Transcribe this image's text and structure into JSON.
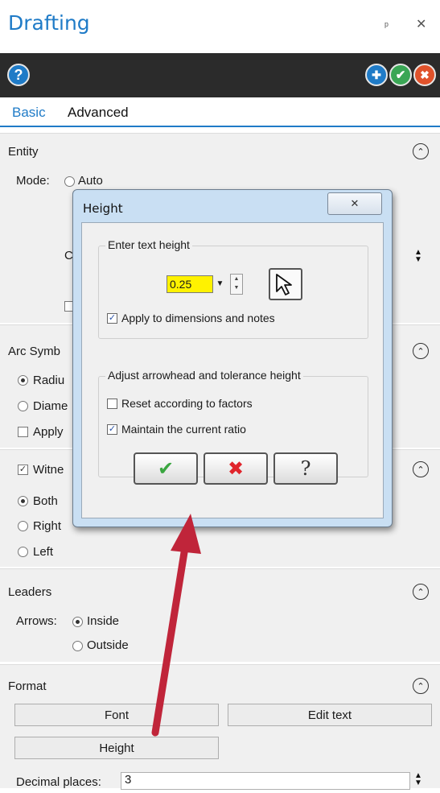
{
  "panel": {
    "title": "Drafting",
    "pin": "ᵖ",
    "close": "✕"
  },
  "toolbar": {
    "help": "?",
    "apply_new": "✚",
    "ok": "✔",
    "cancel": "✖"
  },
  "tabs": [
    {
      "label": "Basic"
    },
    {
      "label": "Advanced"
    }
  ],
  "entity": {
    "title": "Entity",
    "mode_label": "Mode:",
    "auto_label": "Auto",
    "partial_c": "C"
  },
  "arc": {
    "title": "Arc Symb",
    "radius": "Radiu",
    "diameter": "Diame",
    "apply": "Apply"
  },
  "witness": {
    "title": "Witne",
    "both": "Both",
    "right": "Right",
    "left": "Left"
  },
  "leaders": {
    "title": "Leaders",
    "arrows_label": "Arrows:",
    "inside": "Inside",
    "outside": "Outside"
  },
  "format": {
    "title": "Format",
    "font_button": "Font",
    "edit_text_button": "Edit text",
    "height_button": "Height",
    "decimal_label": "Decimal places:",
    "decimal_value": "3"
  },
  "dialog": {
    "title": "Height",
    "close": "✕",
    "group1_title": "Enter text height",
    "height_value": "0.25",
    "apply_dims_label": "Apply to dimensions and notes",
    "group2_title": "Adjust arrowhead and tolerance height",
    "reset_label": "Reset according to factors",
    "maintain_label": "Maintain the current ratio",
    "ok": "✔",
    "cancel": "✖",
    "help": "?"
  },
  "colors": {
    "accent": "#1f7bc7",
    "toolbar": "#2b2b2b",
    "highlight": "#fff200",
    "arrow": "#c0253a"
  }
}
